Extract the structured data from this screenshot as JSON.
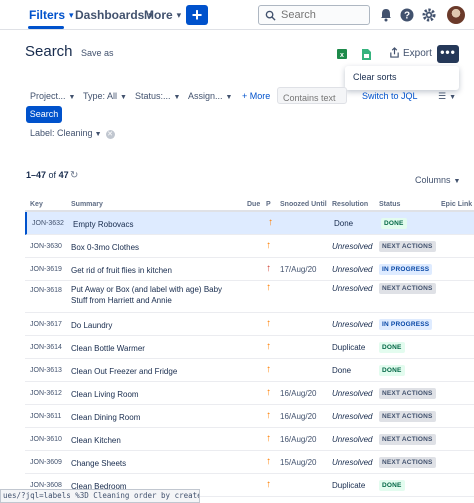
{
  "nav": {
    "items": [
      "Filters",
      "Dashboards",
      "More"
    ],
    "create_label": "+",
    "search_placeholder": "Search"
  },
  "header": {
    "title": "Search",
    "save_as": "Save as",
    "export": "Export",
    "more": "•••",
    "dropdown_item": "Clear sorts"
  },
  "filters": {
    "project": "Project...",
    "type": "Type: All",
    "status": "Status:...",
    "assignee": "Assign...",
    "more": "+ More",
    "contains_placeholder": "Contains text",
    "switch_jql": "Switch to JQL",
    "search_button": "Search",
    "label_chip": "Label: Cleaning"
  },
  "results": {
    "range": "1–47",
    "of": "of",
    "total": "47",
    "columns": "Columns"
  },
  "table": {
    "headers": [
      "Key",
      "Summary",
      "Due",
      "P",
      "Snoozed Until",
      "Resolution",
      "Status",
      "Epic Link"
    ],
    "rows": [
      {
        "key": "JON-3632",
        "summary": "Empty Robovacs",
        "prio": "↑",
        "prio_color": "#ff7f00",
        "snoozed": "",
        "resolution": "Done",
        "status": "DONE",
        "status_type": "done"
      },
      {
        "key": "JON-3630",
        "summary": "Box 0-3mo Clothes",
        "prio": "↑",
        "prio_color": "#ff7f00",
        "snoozed": "",
        "resolution": "Unresolved",
        "status": "NEXT ACTIONS",
        "status_type": "next"
      },
      {
        "key": "JON-3619",
        "summary": "Get rid of fruit flies in kitchen",
        "prio": "↑",
        "prio_color": "#d04437",
        "snoozed": "17/Aug/20",
        "resolution": "Unresolved",
        "status": "IN PROGRESS",
        "status_type": "progress"
      },
      {
        "key": "JON-3618",
        "summary": "Put Away or Box (and label with age) Baby Stuff from Harriett and Annie",
        "prio": "↑",
        "prio_color": "#ff7f00",
        "snoozed": "",
        "resolution": "Unresolved",
        "status": "NEXT ACTIONS",
        "status_type": "next"
      },
      {
        "key": "JON-3617",
        "summary": "Do Laundry",
        "prio": "↑",
        "prio_color": "#ff7f00",
        "snoozed": "",
        "resolution": "Unresolved",
        "status": "IN PROGRESS",
        "status_type": "progress"
      },
      {
        "key": "JON-3614",
        "summary": "Clean Bottle Warmer",
        "prio": "↑",
        "prio_color": "#ff7f00",
        "snoozed": "",
        "resolution": "Duplicate",
        "status": "DONE",
        "status_type": "done"
      },
      {
        "key": "JON-3613",
        "summary": "Clean Out Freezer and Fridge",
        "prio": "↑",
        "prio_color": "#ff7f00",
        "snoozed": "",
        "resolution": "Done",
        "status": "DONE",
        "status_type": "done"
      },
      {
        "key": "JON-3612",
        "summary": "Clean Living Room",
        "prio": "↑",
        "prio_color": "#ff7f00",
        "snoozed": "16/Aug/20",
        "resolution": "Unresolved",
        "status": "NEXT ACTIONS",
        "status_type": "next"
      },
      {
        "key": "JON-3611",
        "summary": "Clean Dining Room",
        "prio": "↑",
        "prio_color": "#ff7f00",
        "snoozed": "16/Aug/20",
        "resolution": "Unresolved",
        "status": "NEXT ACTIONS",
        "status_type": "next"
      },
      {
        "key": "JON-3610",
        "summary": "Clean Kitchen",
        "prio": "↑",
        "prio_color": "#ff7f00",
        "snoozed": "16/Aug/20",
        "resolution": "Unresolved",
        "status": "NEXT ACTIONS",
        "status_type": "next"
      },
      {
        "key": "JON-3609",
        "summary": "Change Sheets",
        "prio": "↑",
        "prio_color": "#ff7f00",
        "snoozed": "15/Aug/20",
        "resolution": "Unresolved",
        "status": "NEXT ACTIONS",
        "status_type": "next"
      },
      {
        "key": "JON-3608",
        "summary": "Clean Bedroom",
        "prio": "↑",
        "prio_color": "#ff7f00",
        "snoozed": "",
        "resolution": "Duplicate",
        "status": "DONE",
        "status_type": "done"
      }
    ]
  },
  "status_colors": {
    "done": {
      "bg": "#e3fcef",
      "fg": "#006644"
    },
    "next": {
      "bg": "#dfe1e6",
      "fg": "#42526e"
    },
    "progress": {
      "bg": "#deebff",
      "fg": "#0747a6"
    }
  },
  "url_hint": "ues/?jql=labels %3D Cleaning order by created DESC#"
}
